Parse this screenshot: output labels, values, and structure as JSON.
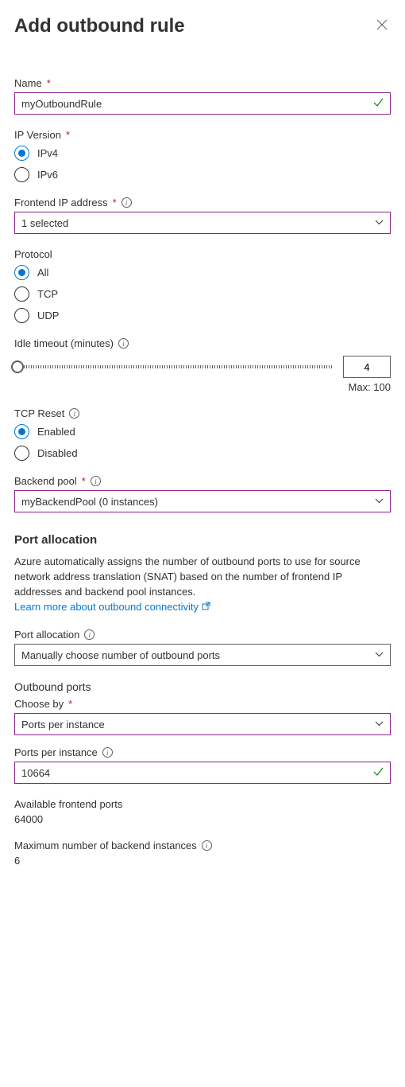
{
  "header": {
    "title": "Add outbound rule"
  },
  "name": {
    "label": "Name",
    "value": "myOutboundRule"
  },
  "ipVersion": {
    "label": "IP Version",
    "options": [
      "IPv4",
      "IPv6"
    ],
    "selected": "IPv4"
  },
  "frontendIp": {
    "label": "Frontend IP address",
    "value": "1 selected"
  },
  "protocol": {
    "label": "Protocol",
    "options": [
      "All",
      "TCP",
      "UDP"
    ],
    "selected": "All"
  },
  "idleTimeout": {
    "label": "Idle timeout (minutes)",
    "value": "4",
    "maxLabel": "Max: 100"
  },
  "tcpReset": {
    "label": "TCP Reset",
    "options": [
      "Enabled",
      "Disabled"
    ],
    "selected": "Enabled"
  },
  "backendPool": {
    "label": "Backend pool",
    "value": "myBackendPool (0 instances)"
  },
  "portAllocation": {
    "heading": "Port allocation",
    "description": "Azure automatically assigns the number of outbound ports to use for source network address translation (SNAT) based on the number of frontend IP addresses and backend pool instances.",
    "linkText": "Learn more about outbound connectivity",
    "selectLabel": "Port allocation",
    "selectValue": "Manually choose number of outbound ports"
  },
  "outboundPorts": {
    "heading": "Outbound ports",
    "chooseByLabel": "Choose by",
    "chooseByValue": "Ports per instance",
    "portsPerInstanceLabel": "Ports per instance",
    "portsPerInstanceValue": "10664",
    "availableLabel": "Available frontend ports",
    "availableValue": "64000",
    "maxInstancesLabel": "Maximum number of backend instances",
    "maxInstancesValue": "6"
  }
}
